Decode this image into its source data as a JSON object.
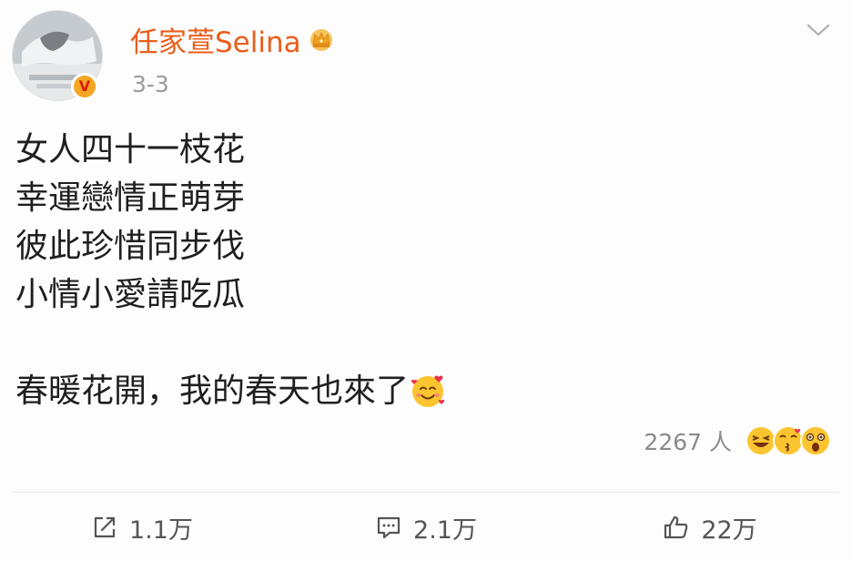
{
  "post": {
    "author": "任家萱Selina",
    "date": "3-3",
    "lines": [
      "女人四十一枝花",
      "幸運戀情正萌芽",
      "彼此珍惜同步伐",
      "小情小愛請吃瓜"
    ],
    "closing": "春暖花開，我的春天也來了"
  },
  "icons": {
    "author_badge": "crown-icon",
    "verified": "verified-v-badge",
    "menu": "chevron-down-icon",
    "closing_emoji": "smiling-face-with-hearts-emoji",
    "repost": "repost-icon",
    "comment": "comment-icon",
    "like": "thumbs-up-icon"
  },
  "colors": {
    "username": "#ea5e1c",
    "verified_badge": "#f5a623",
    "secondary_text": "#9a9a9a"
  },
  "reactions": {
    "count": "2267 人",
    "faces": [
      "laughing-face",
      "kissing-face",
      "surprised-face"
    ]
  },
  "actions": {
    "repost": "1.1万",
    "comment": "2.1万",
    "like": "22万"
  }
}
